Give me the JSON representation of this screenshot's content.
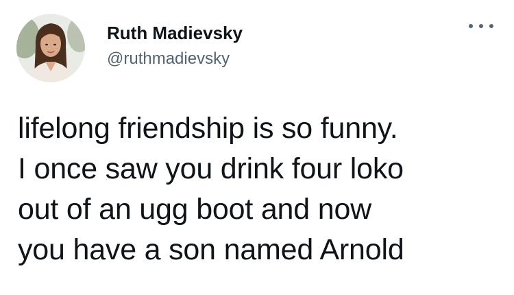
{
  "tweet": {
    "author": {
      "display_name": "Ruth Madievsky",
      "handle": "@ruthmadievsky",
      "avatar_icon": "profile-photo"
    },
    "more_icon": "more-horizontal-icon",
    "text_lines": [
      "lifelong friendship is so funny.",
      "I once saw you drink four loko",
      "out of an ugg boot and now",
      "you have a son named Arnold"
    ]
  },
  "colors": {
    "text": "#0f1419",
    "secondary": "#536471",
    "background": "#ffffff"
  }
}
